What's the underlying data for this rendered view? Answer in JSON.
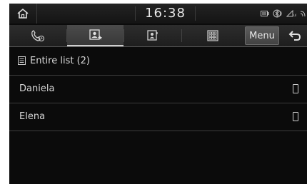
{
  "status_bar": {
    "time": "16:38",
    "icons": [
      "home-icon",
      "media-icon",
      "bluetooth-icon",
      "signal-icon",
      "wifi-icon"
    ]
  },
  "tabs": [
    {
      "icon": "call-history-icon",
      "active": false
    },
    {
      "icon": "favorite-contacts-icon",
      "active": true
    },
    {
      "icon": "contacts-icon",
      "active": false
    },
    {
      "icon": "dial-pad-icon",
      "active": false
    }
  ],
  "toolbar": {
    "menu_label": "Menu",
    "back_icon": "back-icon"
  },
  "list": {
    "header": "Entire list (2)",
    "items": [
      {
        "name": "Daniela"
      },
      {
        "name": "Elena"
      }
    ]
  },
  "colors": {
    "background": "#0b0b0b",
    "text": "#d6d6d6",
    "active_tab": "#444444",
    "divider": "#3c3c3c"
  }
}
